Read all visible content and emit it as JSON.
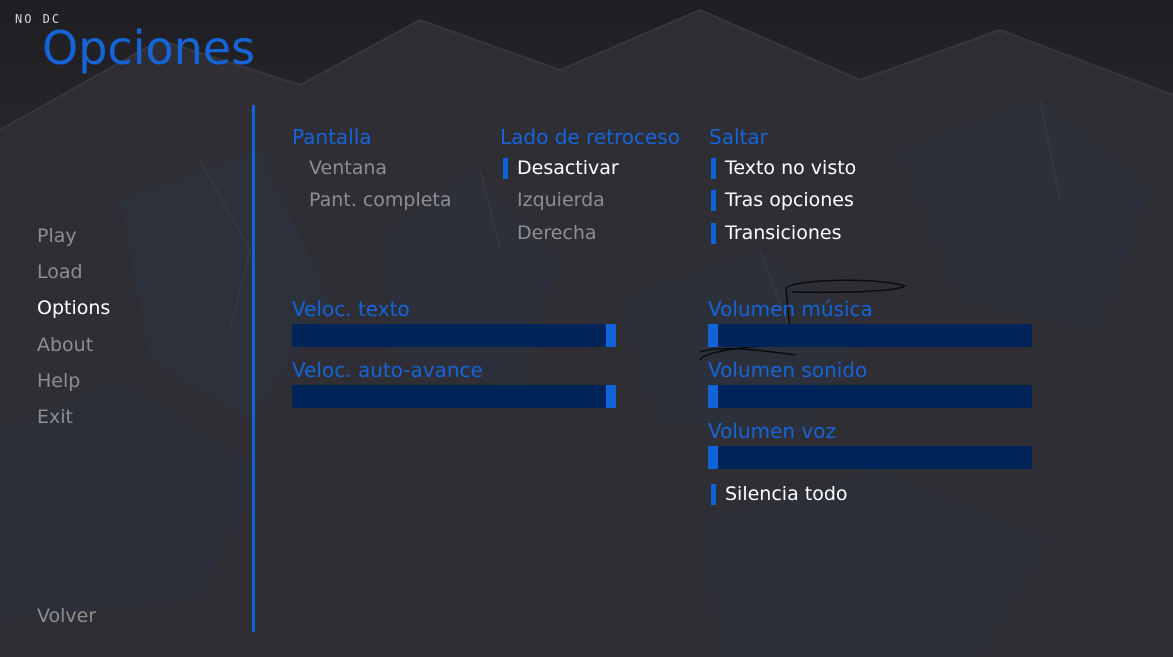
{
  "watermark": "NO DC",
  "title": "Opciones",
  "menu": [
    "Play",
    "Load",
    "Options",
    "About",
    "Help",
    "Exit"
  ],
  "menu_selected": "Options",
  "back": "Volver",
  "display": {
    "heading": "Pantalla",
    "options": [
      "Ventana",
      "Pant. completa"
    ],
    "selected": null
  },
  "rollback": {
    "heading": "Lado de retroceso",
    "options": [
      "Desactivar",
      "Izquierda",
      "Derecha"
    ],
    "selected": "Desactivar"
  },
  "skip": {
    "heading": "Saltar",
    "options": [
      "Texto no visto",
      "Tras opciones",
      "Transiciones"
    ],
    "checked": [
      "Texto no visto",
      "Tras opciones",
      "Transiciones"
    ]
  },
  "sliders": {
    "text_speed": {
      "label": "Veloc. texto",
      "value": 1.0
    },
    "auto_forward": {
      "label": "Veloc. auto-avance",
      "value": 1.0
    },
    "music_volume": {
      "label": "Volumen música",
      "value": 0.0
    },
    "sound_volume": {
      "label": "Volumen sonido",
      "value": 0.0
    },
    "voice_volume": {
      "label": "Volumen voz",
      "value": 0.0
    }
  },
  "mute_all": {
    "label": "Silencia todo",
    "checked": true
  },
  "colors": {
    "accent": "#1565d8",
    "bar": "#012559",
    "text_idle": "#8e8e91",
    "text_active": "#ffffff",
    "background": "#2b2a2f"
  }
}
